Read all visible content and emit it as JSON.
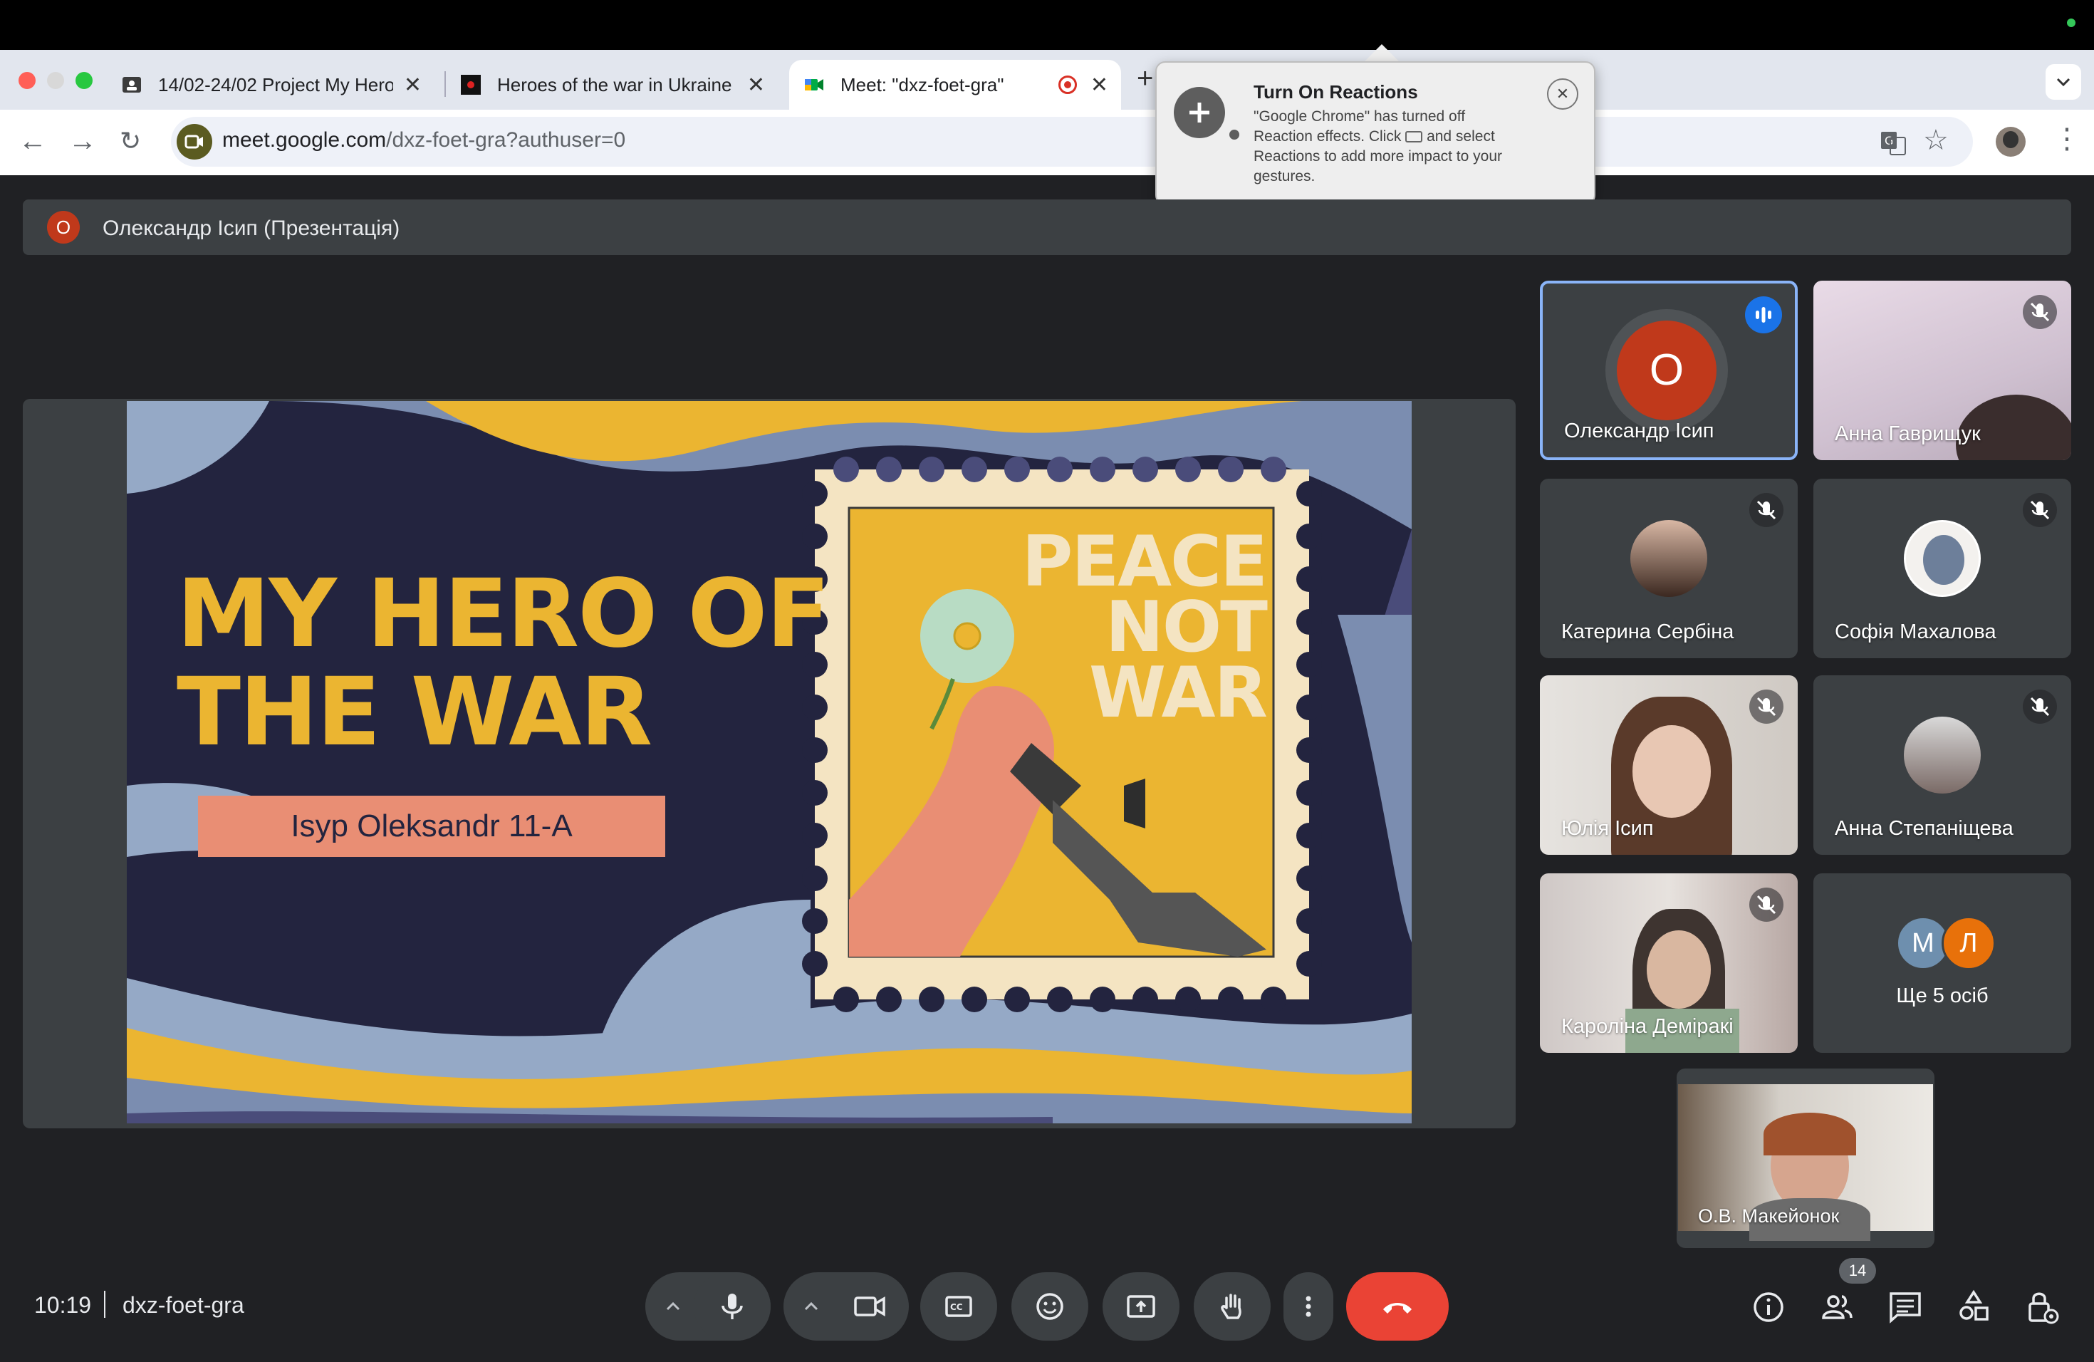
{
  "browser": {
    "tabs": [
      {
        "title": "14/02-24/02 Project My Hero",
        "active": false
      },
      {
        "title": "Heroes of the war in Ukraine -",
        "active": false
      },
      {
        "title": "Meet: \"dxz-foet-gra\"",
        "active": true
      }
    ],
    "url_host": "meet.google.com",
    "url_path": "/dxz-foet-gra?authuser=0"
  },
  "popup": {
    "title": "Turn On Reactions",
    "body_1": "\"Google Chrome\" has turned off",
    "body_2": "Reaction effects. Click",
    "body_2b": "and select",
    "body_3": "Reactions to add more impact to your",
    "body_4": "gestures."
  },
  "presenter": {
    "initial": "О",
    "label": "Олександр Ісип (Презентація)"
  },
  "slide": {
    "title_line1": "MY HERO OF",
    "title_line2": "THE WAR",
    "author": "Isyp Oleksandr 11-A",
    "stamp_line1": "PEACE",
    "stamp_line2": "NOT",
    "stamp_line3": "WAR"
  },
  "participants": [
    {
      "name": "Олександр Ісип",
      "initial": "О",
      "speaking": true
    },
    {
      "name": "Анна Гаврищук",
      "muted": true
    },
    {
      "name": "Катерина Сербіна",
      "muted": true
    },
    {
      "name": "Софія Махалова",
      "muted": true
    },
    {
      "name": "Юлія Ісип",
      "muted": true
    },
    {
      "name": "Анна Степаніщева",
      "muted": true
    },
    {
      "name": "Кароліна Деміракі",
      "muted": true
    },
    {
      "name": "Ще 5 осіб",
      "initials": [
        "М",
        "Л"
      ]
    }
  ],
  "self_view": {
    "name": "О.В. Макейонок"
  },
  "meeting": {
    "time": "10:19",
    "code": "dxz-foet-gra",
    "people_count": "14"
  },
  "colors": {
    "meet_bg": "#202124",
    "tile_bg": "#3c4043",
    "end_call": "#ea4335",
    "speaking_border": "#8ab4f8",
    "slide_yellow": "#ebb531",
    "slide_navy": "#23243f",
    "slide_salmon": "#e98e74"
  }
}
